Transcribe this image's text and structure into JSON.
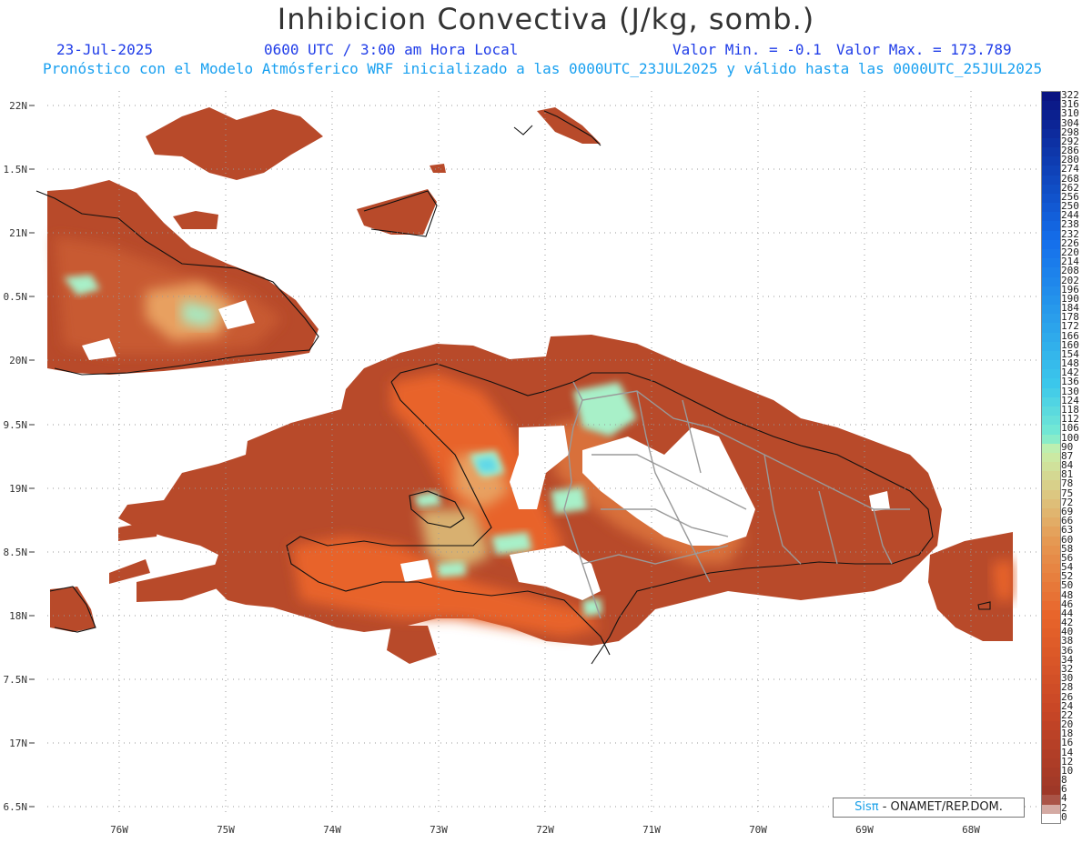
{
  "header": {
    "title": "Inhibicion Convectiva (J/kg, somb.)",
    "date": "23-Jul-2025",
    "time": "0600 UTC / 3:00 am Hora Local",
    "valmin": "Valor Min. = -0.1",
    "valmax": "Valor Max. = 173.789",
    "subtitle": "Pronóstico con el Modelo Atmósferico WRF inicializado a las 0000UTC_23JUL2025 y válido hasta las  0000UTC_25JUL2025"
  },
  "axes": {
    "lat_labels": [
      "22N",
      "1.5N",
      "21N",
      "0.5N",
      "20N",
      "9.5N",
      "19N",
      "8.5N",
      "18N",
      "7.5N",
      "17N",
      "6.5N"
    ],
    "lon_labels": [
      "76W",
      "75W",
      "74W",
      "73W",
      "72W",
      "71W",
      "70W",
      "69W",
      "68W"
    ]
  },
  "legend": {
    "labels": [
      "322",
      "316",
      "310",
      "304",
      "298",
      "292",
      "286",
      "280",
      "274",
      "268",
      "262",
      "256",
      "250",
      "244",
      "238",
      "232",
      "226",
      "220",
      "214",
      "208",
      "202",
      "196",
      "190",
      "184",
      "178",
      "172",
      "166",
      "160",
      "154",
      "148",
      "142",
      "136",
      "130",
      "124",
      "118",
      "112",
      "106",
      "100",
      "90",
      "87",
      "84",
      "81",
      "78",
      "75",
      "72",
      "69",
      "66",
      "63",
      "60",
      "58",
      "56",
      "54",
      "52",
      "50",
      "48",
      "46",
      "44",
      "42",
      "40",
      "38",
      "36",
      "34",
      "32",
      "30",
      "28",
      "26",
      "24",
      "22",
      "20",
      "18",
      "16",
      "14",
      "12",
      "10",
      "8",
      "6",
      "4",
      "2",
      "0"
    ]
  },
  "credit": {
    "sis": "Sisπ",
    "text": " - ONAMET/REP.DOM."
  },
  "colors": {
    "base": "#b84a2a",
    "dark": "#9e3a26",
    "orange": "#e8642a",
    "tan": "#d8b070",
    "mint": "#a8f0c8",
    "cyan": "#60e0e8",
    "blue": "#1a3a8a"
  }
}
